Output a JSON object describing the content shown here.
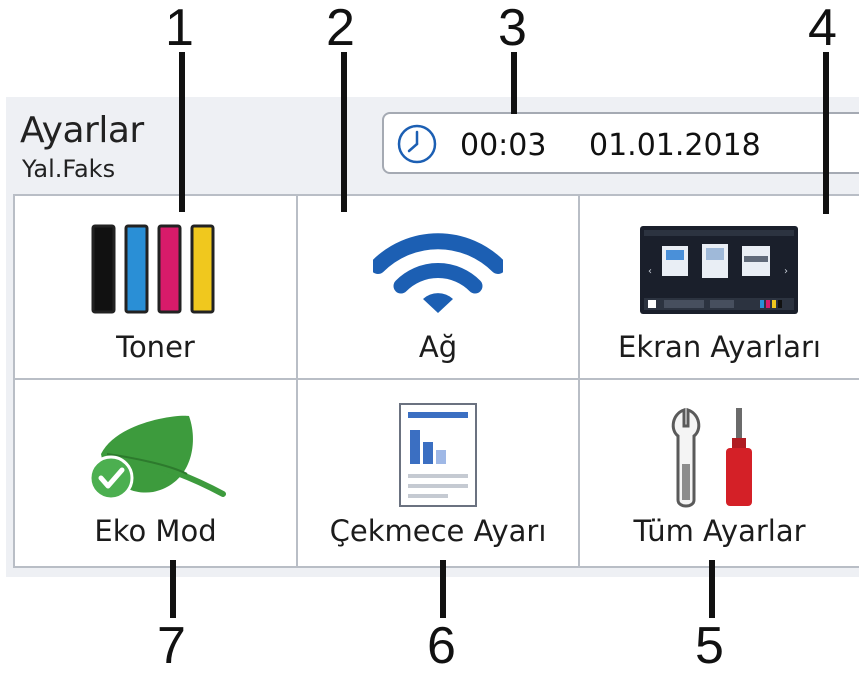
{
  "header": {
    "title": "Ayarlar",
    "subtitle": "Yal.Faks",
    "time": "00:03",
    "date": "01.01.2018"
  },
  "tiles": [
    {
      "label": "Toner",
      "icon": "toner-icon"
    },
    {
      "label": "Ağ",
      "icon": "wifi-icon"
    },
    {
      "label": "Ekran Ayarları",
      "icon": "screen-settings-icon"
    },
    {
      "label": "Eko Mod",
      "icon": "eco-leaf-icon"
    },
    {
      "label": "Çekmece Ayarı",
      "icon": "tray-document-icon"
    },
    {
      "label": "Tüm Ayarlar",
      "icon": "tools-icon"
    }
  ],
  "callouts": [
    "1",
    "2",
    "3",
    "4",
    "7",
    "6",
    "5"
  ],
  "colors": {
    "toner_black": "#111111",
    "toner_cyan": "#2a8fd6",
    "toner_magenta": "#d81b6a",
    "toner_yellow": "#f0c81e",
    "wifi_blue": "#1c5fb3",
    "leaf_green": "#3d9b3d",
    "check_green": "#4caf50",
    "screwdriver_red": "#d42027"
  }
}
